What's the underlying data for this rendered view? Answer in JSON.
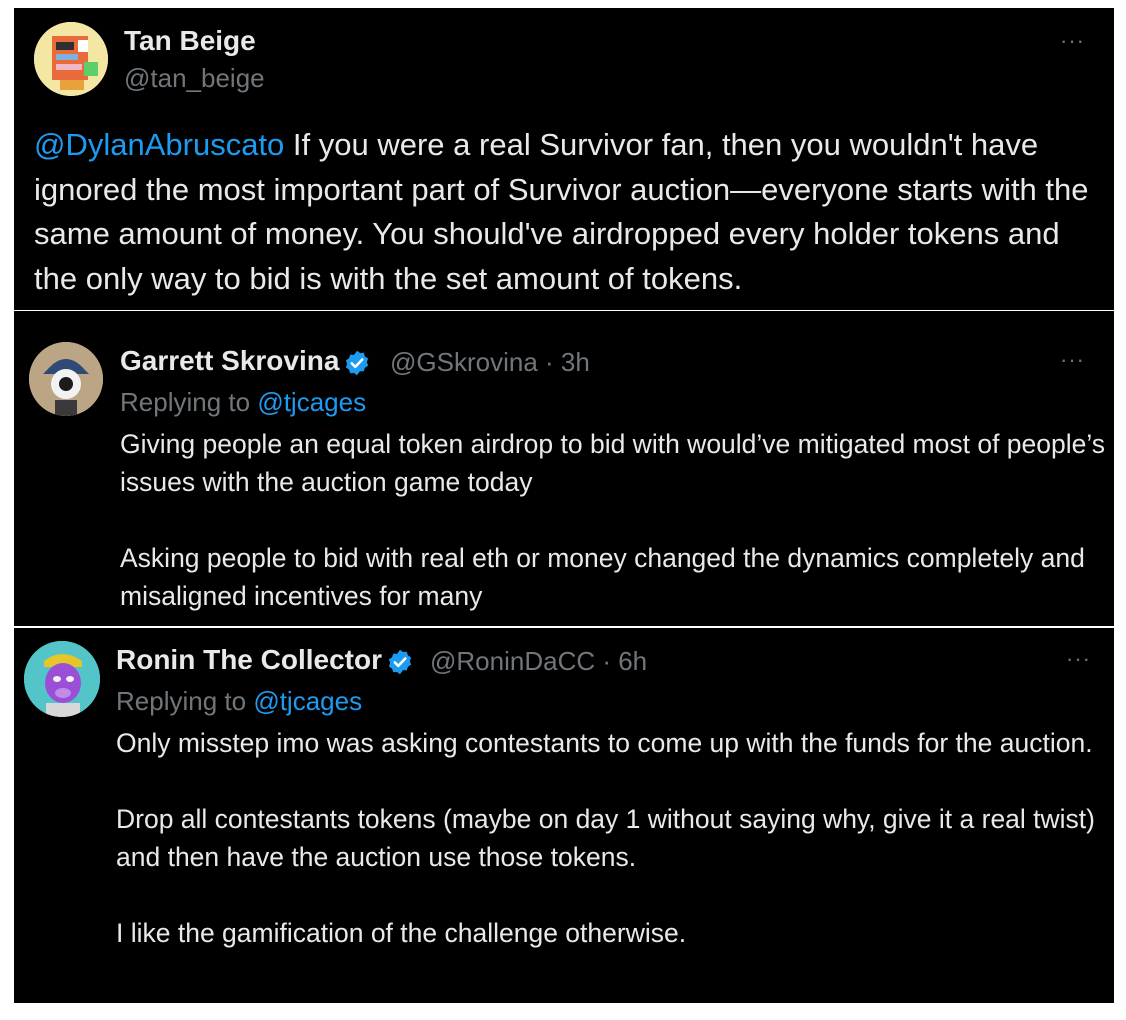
{
  "tweets": [
    {
      "name": "Tan Beige",
      "handle": "@tan_beige",
      "mention": "@DylanAbruscato",
      "text": " If you were a real Survivor fan, then you wouldn't have ignored the most important part of Survivor auction—everyone starts with the same amount of money. You should've airdropped every holder tokens and the only way to bid is with the set amount of tokens.",
      "more": "···"
    },
    {
      "name": "Garrett Skrovina",
      "handle": "@GSkrovina · 3h",
      "replying_prefix": "Replying to ",
      "replying_to": "@tjcages",
      "paragraphs": [
        "Giving people an equal token airdrop to bid with would’ve mitigated most of people’s issues with the auction game today",
        "Asking people to bid with real eth or money changed the dynamics completely and misaligned incentives for many"
      ],
      "more": "···"
    },
    {
      "name": "Ronin The Collector",
      "handle": "@RoninDaCC · 6h",
      "replying_prefix": "Replying to ",
      "replying_to": "@tjcages",
      "paragraphs": [
        "Only misstep imo was asking contestants to come up with the funds for the auction.",
        "Drop all contestants tokens (maybe on day 1 without saying why, give it a real twist) and then have the auction use those tokens.",
        "I like the gamification of the challenge otherwise."
      ],
      "more": "···"
    }
  ],
  "colors": {
    "background": "#000000",
    "text": "#e7e9ea",
    "secondary": "#71767b",
    "link": "#1d9bf0",
    "verified": "#1d9bf0"
  },
  "icons": [
    "avatar-tan-beige",
    "avatar-garrett",
    "avatar-ronin",
    "verified-badge-icon",
    "more-options-icon"
  ]
}
